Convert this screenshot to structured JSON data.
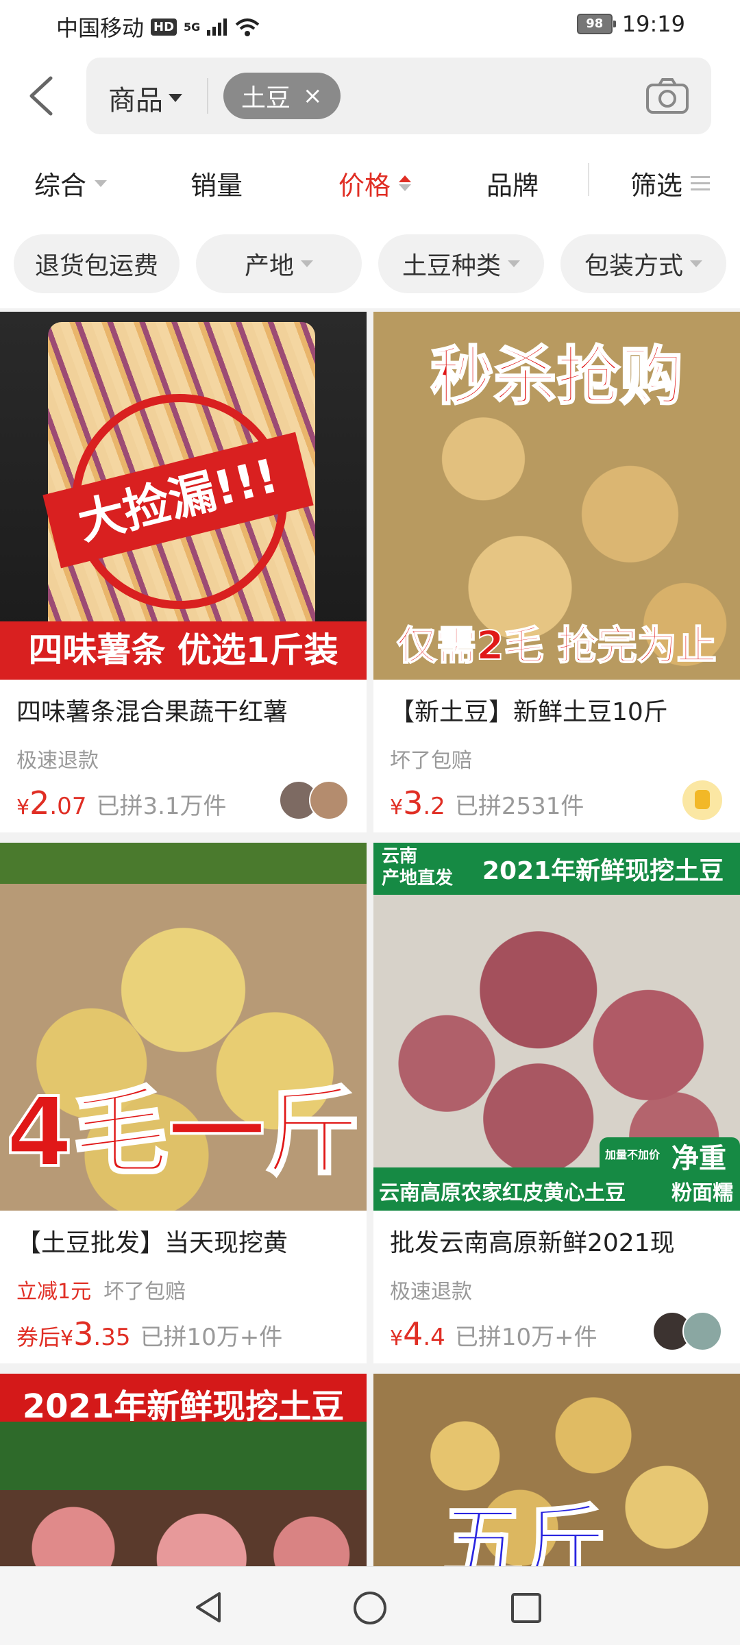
{
  "status": {
    "carrier": "中国移动",
    "hd": "HD",
    "network": "5G",
    "battery": "98",
    "time": "19:19"
  },
  "search": {
    "scope": "商品",
    "chip": "土豆",
    "chip_close": "×"
  },
  "sort": {
    "items": [
      "综合",
      "销量",
      "价格",
      "品牌",
      "筛选"
    ],
    "active": "价格"
  },
  "filters": [
    "退货包运费",
    "产地",
    "土豆种类",
    "包装方式"
  ],
  "products": [
    {
      "title": "四味薯条混合果蔬干红薯",
      "tags": [
        "极速退款"
      ],
      "currency": "¥",
      "price_int": "2",
      "price_dec": ".07",
      "sold": "已拼3.1万件",
      "image_text": {
        "badge": "大捡漏!!!",
        "banner": "四味薯条 优选1斤装"
      }
    },
    {
      "title": "【新土豆】新鲜土豆10斤",
      "tags": [
        "坏了包赔"
      ],
      "currency": "¥",
      "price_int": "3",
      "price_dec": ".2",
      "sold": "已拼2531件",
      "image_text": {
        "top": "秒杀抢购",
        "bottom": "仅需2毛 抢完为止"
      }
    },
    {
      "title": "【土豆批发】当天现挖黄",
      "tags": [
        "立减1元",
        "坏了包赔"
      ],
      "prefix": "券后",
      "currency": "¥",
      "price_int": "3",
      "price_dec": ".35",
      "sold": "已拼10万+件",
      "image_text": {
        "big": "4毛一斤"
      }
    },
    {
      "title": "批发云南高原新鲜2021现",
      "tags": [
        "极速退款"
      ],
      "currency": "¥",
      "price_int": "4",
      "price_dec": ".4",
      "sold": "已拼10万+件",
      "image_text": {
        "corner": "云南\n产地直发",
        "top": "2021年新鲜现挖土豆",
        "note": "加量不加价",
        "weight": "净重",
        "bottom": "云南高原农家红皮黄心土豆",
        "bottom2": "粉面糯"
      }
    },
    {
      "image_text": {
        "top": "2021年新鲜现挖土豆"
      }
    },
    {
      "image_text": {
        "big": "五斤"
      }
    }
  ],
  "colors": {
    "accent": "#e02e24"
  }
}
